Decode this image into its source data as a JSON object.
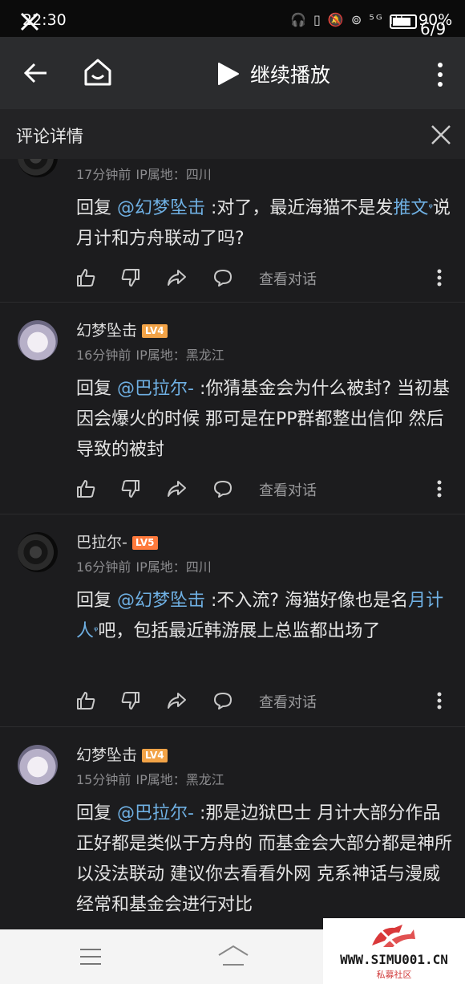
{
  "status": {
    "time": "22:30",
    "icons": "🎧 ▯ 🔕 ⊚ ⁵ᴳ ıll",
    "battery": "90%",
    "page_counter": "6/9"
  },
  "topbar": {
    "play_label": "继续播放"
  },
  "sheet": {
    "title": "评论详情"
  },
  "comments": [
    {
      "meta_time": "17分钟前",
      "meta_ip": "IP属地：四川",
      "body_prefix": "回复 ",
      "body_at": "@幻梦坠击",
      "body_t1": " :对了，最近海猫不是发",
      "body_kw": "推文",
      "body_t2": "说月计和方舟联动了吗?",
      "action_label": "查看对话"
    },
    {
      "username": "幻梦坠击",
      "level": "LV4",
      "meta_time": "16分钟前",
      "meta_ip": "IP属地：黑龙江",
      "body_prefix": "回复 ",
      "body_at": "@巴拉尔-",
      "body_t1": " :你猜基金会为什么被封? 当初基因会爆火的时候 那可是在PP群都整出信仰 然后导致的被封",
      "action_label": "查看对话"
    },
    {
      "username": "巴拉尔-",
      "level": "LV5",
      "meta_time": "16分钟前",
      "meta_ip": "IP属地：四川",
      "body_prefix": "回复 ",
      "body_at": "@幻梦坠击",
      "body_t1": " :不入流? 海猫好像也是名",
      "body_kw": "月计人",
      "body_t2": "吧，包括最近韩游展上总监都出场了",
      "action_label": "查看对话"
    },
    {
      "username": "幻梦坠击",
      "level": "LV4",
      "meta_time": "15分钟前",
      "meta_ip": "IP属地：黑龙江",
      "body_prefix": "回复 ",
      "body_at": "@巴拉尔-",
      "body_t1": " :那是边狱巴士 月计大部分作品正好都是类似于方舟的 而基金会大部分都是神所以没法联动 建议你去看看外网 克系神话与漫威经常和基金会进行对比"
    }
  ],
  "watermark": {
    "url": "WWW.SIMU001.CN",
    "sub": "私募社区"
  },
  "colors": {
    "accent_link": "#6fb0e3",
    "level_badge": "#f2a347"
  }
}
